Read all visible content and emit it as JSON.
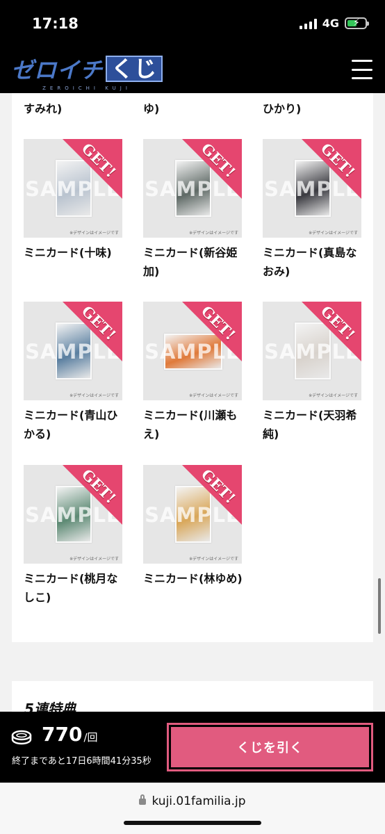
{
  "status_bar": {
    "time": "17:18",
    "network": "4G"
  },
  "header": {
    "logo_text": "ゼロイチ",
    "logo_kuji": "くじ",
    "logo_sub": "ZEROICHI KUJI"
  },
  "cut_names": [
    "すみれ)",
    "ゆ)",
    "ひかり)"
  ],
  "cards": [
    {
      "caption": "ミニカード(十味)",
      "badge": "GET!",
      "watermark": "SAMPLE",
      "note": "※デザインはイメージです",
      "photo_color": "#b9c3cf"
    },
    {
      "caption": "ミニカード(新谷姫加)",
      "badge": "GET!",
      "watermark": "SAMPLE",
      "note": "※デザインはイメージです",
      "photo_color": "#5f6a66"
    },
    {
      "caption": "ミニカード(真島なおみ)",
      "badge": "GET!",
      "watermark": "SAMPLE",
      "note": "※デザインはイメージです",
      "photo_color": "#3a3a40"
    },
    {
      "caption": "ミニカード(青山ひかる)",
      "badge": "GET!",
      "watermark": "SAMPLE",
      "note": "※デザインはイメージです",
      "photo_color": "#5a7fa0"
    },
    {
      "caption": "ミニカード(川瀬もえ)",
      "badge": "GET!",
      "watermark": "SAMPLE",
      "note": "※デザインはイメージです",
      "photo_color": "#e07a3a"
    },
    {
      "caption": "ミニカード(天羽希純)",
      "badge": "GET!",
      "watermark": "SAMPLE",
      "note": "※デザインはイメージです",
      "photo_color": "#d8d2cc"
    },
    {
      "caption": "ミニカード(桃月なしこ)",
      "badge": "GET!",
      "watermark": "SAMPLE",
      "note": "※デザインはイメージです",
      "photo_color": "#5d8a74"
    },
    {
      "caption": "ミニカード(林ゆめ)",
      "badge": "GET!",
      "watermark": "SAMPLE",
      "note": "※デザインはイメージです",
      "photo_color": "#d9a75a"
    }
  ],
  "section2": {
    "title": "5連特典"
  },
  "bottom_bar": {
    "price": "770",
    "unit": "/回",
    "remaining": "終了まであと17日6時間41分35秒",
    "draw_button": "くじを引く"
  },
  "browser": {
    "url": "kuji.01familia.jp"
  },
  "colors": {
    "accent": "#e15b7f",
    "ribbon": "#e5466f",
    "logo": "#4b78c8"
  }
}
